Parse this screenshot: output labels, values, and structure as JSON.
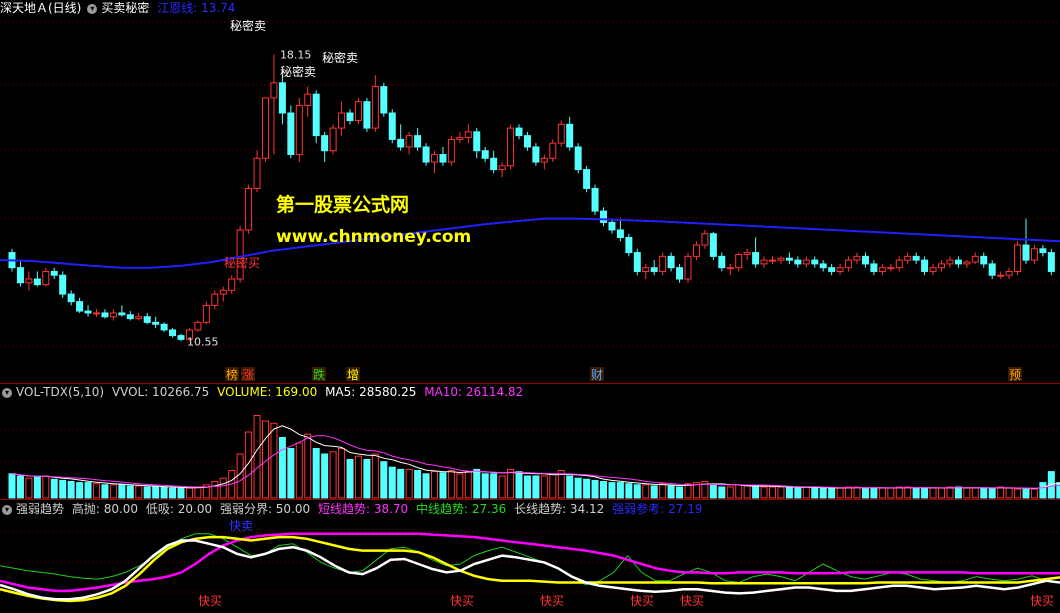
{
  "header": {
    "stock": "深天地Ａ(日线)",
    "indicator": "买卖秘密",
    "ma_label": "江恩线: 13.74"
  },
  "watermark": {
    "line1": "第一股票公式网",
    "line2": "www.chnmoney.com"
  },
  "price_annotations": {
    "high": "18.15",
    "low": "10.55",
    "sell1": "秘密卖",
    "sell2": "秘密卖",
    "sell3": "秘密卖",
    "buy": "秘密买"
  },
  "event_markers": [
    "榜",
    "涨",
    "跌",
    "增",
    "财",
    "预"
  ],
  "vol_header": {
    "name": "VOL-TDX(5,10)",
    "vvol": "VVOL: 10266.75",
    "volume": "VOLUME: 169.00",
    "ma5": "MA5: 28580.25",
    "ma10": "MA10: 26114.82"
  },
  "trend_header": {
    "name": "强弱趋势",
    "high": "高抛: 80.00",
    "low": "低吸: 20.00",
    "boundary": "强弱分界: 50.00",
    "short": "短线趋势: 38.70",
    "mid": "中线趋势: 27.36",
    "long": "长线趋势: 34.12",
    "strength": "强弱参考: 27.19"
  },
  "trend_labels": {
    "sell": "快卖",
    "buy": "快买"
  },
  "colors": {
    "up": "#ff3232",
    "down": "#54ffff",
    "ma": "#2020ff",
    "short": "#ff00ff",
    "mid": "#ffffff",
    "long": "#ffff00",
    "ref": "#22cc22"
  },
  "chart_data": {
    "type": "candlestick",
    "price_range": [
      10.0,
      18.8
    ],
    "candles": [
      [
        12.9,
        13.0,
        12.4,
        12.5
      ],
      [
        12.5,
        12.7,
        12.0,
        12.1
      ],
      [
        12.1,
        12.4,
        11.9,
        12.2
      ],
      [
        12.2,
        12.4,
        12.0,
        12.05
      ],
      [
        12.05,
        12.5,
        12.0,
        12.4
      ],
      [
        12.4,
        12.5,
        12.2,
        12.3
      ],
      [
        12.3,
        12.4,
        11.7,
        11.8
      ],
      [
        11.8,
        11.9,
        11.5,
        11.6
      ],
      [
        11.6,
        11.7,
        11.3,
        11.35
      ],
      [
        11.35,
        11.5,
        11.2,
        11.3
      ],
      [
        11.3,
        11.4,
        11.2,
        11.3
      ],
      [
        11.3,
        11.4,
        11.15,
        11.2
      ],
      [
        11.2,
        11.4,
        11.1,
        11.3
      ],
      [
        11.3,
        11.5,
        11.2,
        11.25
      ],
      [
        11.25,
        11.35,
        11.1,
        11.15
      ],
      [
        11.15,
        11.3,
        11.1,
        11.2
      ],
      [
        11.2,
        11.3,
        11.0,
        11.05
      ],
      [
        11.05,
        11.2,
        10.9,
        11.0
      ],
      [
        11.0,
        11.05,
        10.8,
        10.85
      ],
      [
        10.85,
        10.9,
        10.65,
        10.7
      ],
      [
        10.7,
        10.75,
        10.55,
        10.6
      ],
      [
        10.6,
        10.9,
        10.55,
        10.85
      ],
      [
        10.85,
        11.1,
        10.8,
        11.05
      ],
      [
        11.05,
        11.6,
        11.0,
        11.5
      ],
      [
        11.5,
        11.9,
        11.4,
        11.8
      ],
      [
        11.8,
        12.0,
        11.6,
        11.9
      ],
      [
        11.9,
        12.3,
        11.8,
        12.2
      ],
      [
        12.2,
        13.6,
        12.1,
        13.5
      ],
      [
        13.5,
        14.7,
        13.4,
        14.6
      ],
      [
        14.6,
        15.6,
        14.5,
        15.4
      ],
      [
        15.4,
        17.0,
        15.3,
        17.0
      ],
      [
        17.0,
        18.15,
        15.5,
        17.4
      ],
      [
        17.4,
        17.6,
        16.3,
        16.6
      ],
      [
        16.6,
        16.8,
        15.4,
        15.5
      ],
      [
        15.5,
        17.0,
        15.3,
        16.8
      ],
      [
        16.8,
        17.3,
        16.5,
        17.1
      ],
      [
        17.1,
        17.2,
        15.8,
        16.0
      ],
      [
        16.0,
        16.1,
        15.3,
        15.6
      ],
      [
        15.6,
        16.3,
        15.5,
        16.2
      ],
      [
        16.2,
        16.9,
        16.0,
        16.6
      ],
      [
        16.6,
        16.7,
        16.3,
        16.4
      ],
      [
        16.4,
        17.0,
        16.3,
        16.9
      ],
      [
        16.9,
        17.0,
        16.1,
        16.2
      ],
      [
        16.2,
        17.6,
        16.1,
        17.3
      ],
      [
        17.3,
        17.4,
        16.5,
        16.6
      ],
      [
        16.6,
        16.7,
        15.8,
        15.9
      ],
      [
        15.9,
        16.3,
        15.6,
        15.7
      ],
      [
        15.7,
        16.1,
        15.5,
        16.0
      ],
      [
        16.0,
        16.2,
        15.6,
        15.7
      ],
      [
        15.7,
        15.8,
        15.2,
        15.3
      ],
      [
        15.3,
        15.6,
        15.0,
        15.5
      ],
      [
        15.5,
        15.7,
        15.2,
        15.3
      ],
      [
        15.3,
        16.0,
        15.2,
        15.9
      ],
      [
        15.9,
        16.1,
        15.8,
        15.95
      ],
      [
        15.95,
        16.3,
        15.8,
        16.1
      ],
      [
        16.1,
        16.2,
        15.4,
        15.6
      ],
      [
        15.6,
        15.7,
        15.3,
        15.4
      ],
      [
        15.4,
        15.6,
        15.0,
        15.1
      ],
      [
        15.1,
        15.3,
        14.9,
        15.2
      ],
      [
        15.2,
        16.3,
        15.1,
        16.2
      ],
      [
        16.2,
        16.3,
        15.9,
        16.0
      ],
      [
        16.0,
        16.1,
        15.6,
        15.7
      ],
      [
        15.7,
        15.8,
        15.2,
        15.3
      ],
      [
        15.3,
        15.5,
        15.1,
        15.4
      ],
      [
        15.4,
        15.9,
        15.3,
        15.8
      ],
      [
        15.8,
        16.4,
        15.7,
        16.3
      ],
      [
        16.3,
        16.5,
        15.6,
        15.7
      ],
      [
        15.7,
        15.8,
        15.0,
        15.1
      ],
      [
        15.1,
        15.2,
        14.5,
        14.6
      ],
      [
        14.6,
        14.7,
        13.9,
        14.0
      ],
      [
        14.0,
        14.1,
        13.6,
        13.7
      ],
      [
        13.7,
        13.8,
        13.4,
        13.5
      ],
      [
        13.5,
        13.8,
        13.2,
        13.3
      ],
      [
        13.3,
        13.4,
        12.8,
        12.9
      ],
      [
        12.9,
        13.0,
        12.3,
        12.4
      ],
      [
        12.4,
        12.6,
        12.2,
        12.5
      ],
      [
        12.5,
        12.7,
        12.3,
        12.4
      ],
      [
        12.4,
        12.9,
        12.3,
        12.8
      ],
      [
        12.8,
        12.9,
        12.4,
        12.5
      ],
      [
        12.5,
        12.6,
        12.1,
        12.2
      ],
      [
        12.2,
        12.9,
        12.1,
        12.8
      ],
      [
        12.8,
        13.2,
        12.7,
        13.1
      ],
      [
        13.1,
        13.5,
        13.0,
        13.4
      ],
      [
        13.4,
        13.45,
        12.7,
        12.8
      ],
      [
        12.8,
        12.9,
        12.4,
        12.5
      ],
      [
        12.5,
        12.6,
        12.3,
        12.5
      ],
      [
        12.5,
        12.9,
        12.4,
        12.85
      ],
      [
        12.85,
        13.0,
        12.7,
        12.9
      ],
      [
        12.9,
        13.3,
        12.5,
        12.6
      ],
      [
        12.6,
        12.8,
        12.5,
        12.7
      ],
      [
        12.7,
        12.8,
        12.6,
        12.7
      ],
      [
        12.7,
        12.8,
        12.6,
        12.75
      ],
      [
        12.75,
        12.9,
        12.6,
        12.7
      ],
      [
        12.7,
        12.8,
        12.5,
        12.6
      ],
      [
        12.6,
        12.8,
        12.5,
        12.7
      ],
      [
        12.7,
        12.8,
        12.5,
        12.6
      ],
      [
        12.6,
        12.7,
        12.4,
        12.5
      ],
      [
        12.5,
        12.6,
        12.3,
        12.4
      ],
      [
        12.4,
        12.6,
        12.3,
        12.5
      ],
      [
        12.5,
        12.8,
        12.4,
        12.7
      ],
      [
        12.7,
        12.9,
        12.6,
        12.8
      ],
      [
        12.8,
        12.9,
        12.5,
        12.6
      ],
      [
        12.6,
        12.7,
        12.3,
        12.4
      ],
      [
        12.4,
        12.6,
        12.3,
        12.5
      ],
      [
        12.5,
        12.6,
        12.4,
        12.5
      ],
      [
        12.5,
        12.8,
        12.4,
        12.7
      ],
      [
        12.7,
        12.9,
        12.6,
        12.8
      ],
      [
        12.8,
        12.9,
        12.6,
        12.7
      ],
      [
        12.7,
        12.8,
        12.3,
        12.4
      ],
      [
        12.4,
        12.6,
        12.3,
        12.5
      ],
      [
        12.5,
        12.7,
        12.4,
        12.6
      ],
      [
        12.6,
        12.8,
        12.5,
        12.7
      ],
      [
        12.7,
        12.8,
        12.5,
        12.6
      ],
      [
        12.6,
        12.7,
        12.5,
        12.65
      ],
      [
        12.65,
        12.9,
        12.6,
        12.8
      ],
      [
        12.8,
        12.9,
        12.5,
        12.6
      ],
      [
        12.6,
        12.7,
        12.2,
        12.3
      ],
      [
        12.3,
        12.4,
        12.2,
        12.3
      ],
      [
        12.3,
        12.5,
        12.2,
        12.4
      ],
      [
        12.4,
        13.2,
        12.3,
        13.1
      ],
      [
        13.1,
        13.8,
        12.6,
        12.7
      ],
      [
        12.7,
        13.1,
        12.6,
        13.0
      ],
      [
        13.0,
        13.1,
        12.8,
        12.9
      ],
      [
        12.9,
        13.0,
        12.3,
        12.4
      ]
    ],
    "ma_line": [
      12.7,
      12.68,
      12.62,
      12.55,
      12.5,
      12.5,
      12.55,
      12.65,
      12.8,
      12.95,
      13.05,
      13.15,
      13.25,
      13.35,
      13.45,
      13.55,
      13.65,
      13.73,
      13.8,
      13.8,
      13.78,
      13.75,
      13.72,
      13.68,
      13.64,
      13.6,
      13.56,
      13.52,
      13.48,
      13.44,
      13.4,
      13.36,
      13.32,
      13.28,
      13.24,
      13.2
    ],
    "volume": [
      22,
      20,
      18,
      19,
      20,
      17,
      16,
      15,
      14,
      14,
      13,
      12,
      12,
      12,
      11,
      11,
      10,
      10,
      10,
      9,
      9,
      9,
      10,
      12,
      15,
      18,
      25,
      40,
      60,
      75,
      70,
      68,
      55,
      45,
      50,
      58,
      45,
      40,
      42,
      45,
      35,
      38,
      35,
      40,
      33,
      28,
      26,
      26,
      25,
      22,
      24,
      23,
      25,
      22,
      24,
      26,
      22,
      22,
      20,
      26,
      24,
      20,
      20,
      20,
      22,
      25,
      20,
      18,
      17,
      16,
      15,
      14,
      14,
      13,
      12,
      12,
      11,
      13,
      11,
      10,
      13,
      14,
      15,
      12,
      10,
      10,
      12,
      11,
      11,
      10,
      10,
      10,
      10,
      9,
      10,
      9,
      9,
      9,
      9,
      10,
      10,
      9,
      9,
      9,
      9,
      10,
      10,
      9,
      9,
      9,
      9,
      10,
      10,
      9,
      9,
      9,
      9,
      10,
      9,
      8,
      8,
      8,
      14,
      24,
      14,
      12,
      6
    ],
    "short_trend": [
      30,
      26,
      22,
      20,
      18,
      18,
      20,
      22,
      25,
      28,
      30,
      32,
      35,
      40,
      50,
      62,
      72,
      78,
      82,
      84,
      85,
      86,
      86,
      86,
      86,
      86,
      86,
      86,
      86,
      86,
      86,
      85,
      84,
      83,
      82,
      80,
      78,
      76,
      74,
      72,
      70,
      68,
      66,
      63,
      60,
      55,
      50,
      45,
      42,
      40,
      40,
      39,
      39,
      40,
      40,
      40,
      40,
      39,
      39,
      39,
      39,
      40,
      40,
      40,
      40,
      40,
      40,
      40,
      40,
      40,
      39,
      39,
      39,
      39,
      39,
      39,
      39
    ],
    "mid_trend": [
      25,
      20,
      14,
      10,
      8,
      8,
      10,
      14,
      20,
      30,
      45,
      60,
      72,
      78,
      78,
      74,
      70,
      62,
      58,
      62,
      68,
      70,
      66,
      58,
      48,
      40,
      38,
      45,
      55,
      56,
      50,
      44,
      40,
      42,
      50,
      55,
      60,
      58,
      55,
      52,
      45,
      35,
      28,
      24,
      22,
      20,
      18,
      17,
      18,
      20,
      20,
      18,
      16,
      15,
      16,
      18,
      20,
      22,
      22,
      20,
      18,
      18,
      20,
      22,
      24,
      24,
      22,
      20,
      21,
      22,
      24,
      22,
      20,
      22,
      26,
      30,
      28
    ],
    "long_trend": [
      20,
      16,
      12,
      9,
      7,
      6,
      7,
      10,
      15,
      24,
      38,
      54,
      68,
      76,
      80,
      82,
      82,
      80,
      78,
      80,
      82,
      82,
      80,
      76,
      72,
      68,
      66,
      66,
      66,
      66,
      64,
      58,
      50,
      42,
      36,
      32,
      30,
      30,
      30,
      29,
      28,
      28,
      28,
      28,
      28,
      28,
      28,
      28,
      28,
      28,
      28,
      27,
      27,
      27,
      27,
      27,
      27,
      27,
      27,
      27,
      27,
      27,
      27,
      28,
      28,
      28,
      28,
      28,
      28,
      28,
      28,
      28,
      28,
      28,
      30,
      32,
      34
    ],
    "ref_line": [
      48,
      45,
      42,
      40,
      38,
      35,
      33,
      32,
      35,
      40,
      48,
      58,
      70,
      80,
      86,
      86,
      80,
      70,
      60,
      62,
      72,
      74,
      64,
      52,
      45,
      40,
      42,
      55,
      68,
      70,
      64,
      55,
      48,
      50,
      60,
      66,
      70,
      64,
      58,
      52,
      45,
      35,
      25,
      30,
      40,
      60,
      40,
      30,
      30,
      38,
      45,
      40,
      30,
      28,
      35,
      38,
      35,
      30,
      40,
      50,
      42,
      35,
      32,
      36,
      40,
      38,
      32,
      30,
      28,
      30,
      35,
      32,
      30,
      32,
      36,
      30,
      28
    ]
  }
}
